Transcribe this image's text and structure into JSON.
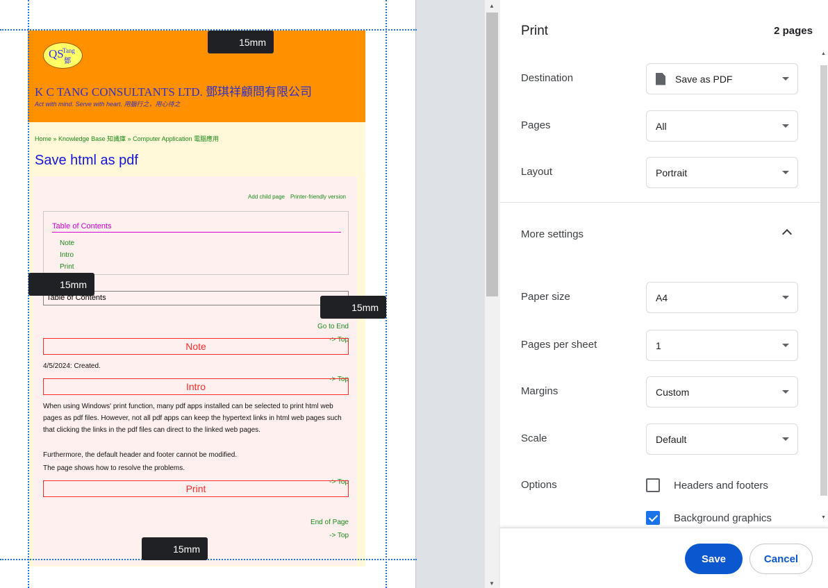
{
  "preview": {
    "margin_label": "15mm",
    "site": {
      "logo": {
        "qs": "QS",
        "tang": "Tang",
        "deng": "鄧"
      },
      "company": "K C TANG CONSULTANTS LTD. 鄧琪祥顧問有限公司",
      "motto": "Act with mind. Serve with heart. 用腦行之，用心待之",
      "breadcrumb": {
        "home": "Home",
        "sep": " » ",
        "kb": "Knowledge Base 知識庫",
        "ca": "Computer Application 電腦應用"
      },
      "title": "Save html as pdf",
      "tools": {
        "add_child": "Add child page",
        "printer_friendly": "Printer-friendly version"
      },
      "toc": {
        "title": "Table of Contents",
        "items": [
          "Note",
          "Intro",
          "Print"
        ]
      },
      "toc_box_label": "Table of Contents",
      "go_to_end": "Go to End",
      "top_link": "-> Top",
      "sections": {
        "note": {
          "heading": "Note",
          "text": "4/5/2024: Created."
        },
        "intro": {
          "heading": "Intro",
          "p1": "When using Windows' print function, many pdf apps installed can be selected to print html web pages as pdf files. However, not all pdf apps can keep the hypertext links in html web pages such that clicking the links in the pdf files can direct to the linked web pages.",
          "p2": "Furthermore, the default header and footer cannot be modified.",
          "p3": "The page shows how to resolve the problems."
        },
        "print": {
          "heading": "Print"
        }
      },
      "end_of_page": "End of Page"
    }
  },
  "panel": {
    "title": "Print",
    "pages_count": "2 pages",
    "destination": {
      "label": "Destination",
      "value": "Save as PDF",
      "icon": "pdf-file-icon"
    },
    "pages": {
      "label": "Pages",
      "value": "All"
    },
    "layout": {
      "label": "Layout",
      "value": "Portrait"
    },
    "more_settings": {
      "label": "More settings",
      "icon": "chevron-up-icon"
    },
    "paper_size": {
      "label": "Paper size",
      "value": "A4"
    },
    "pages_per_sheet": {
      "label": "Pages per sheet",
      "value": "1"
    },
    "margins": {
      "label": "Margins",
      "value": "Custom"
    },
    "scale": {
      "label": "Scale",
      "value": "Default"
    },
    "options": {
      "label": "Options",
      "headers_footers": {
        "label": "Headers and footers",
        "checked": false
      },
      "background_graphics": {
        "label": "Background graphics",
        "checked": true
      }
    },
    "buttons": {
      "save": "Save",
      "cancel": "Cancel"
    },
    "accent_color": "#0b57d0"
  }
}
